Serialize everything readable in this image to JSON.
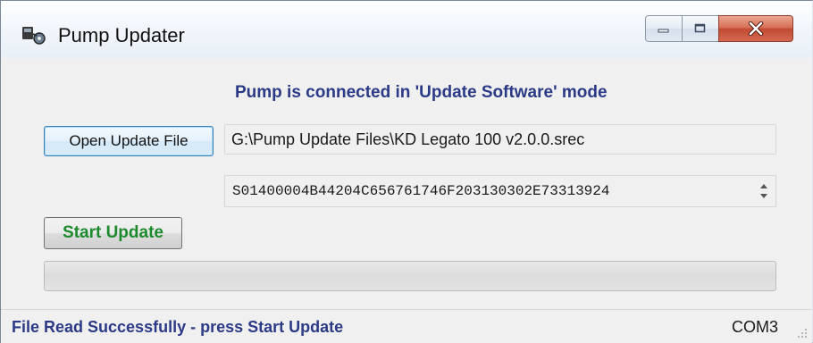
{
  "window": {
    "title": "Pump Updater",
    "app_icon": "pump-updater-app-icon",
    "controls": {
      "minimize_icon": "minimize-icon",
      "maximize_icon": "maximize-icon",
      "close_icon": "close-icon"
    }
  },
  "main": {
    "connection_message": "Pump is connected in 'Update Software' mode",
    "open_button_label": "Open Update File",
    "file_path": "G:\\Pump Update Files\\KD Legato 100 v2.0.0.srec",
    "srec_line": "S01400004B44204C656761746F203130302E73313924",
    "start_button_label": "Start Update",
    "progress_fraction": 0
  },
  "statusbar": {
    "message": "File Read Successfully - press Start Update",
    "port": "COM3"
  },
  "colors": {
    "status_text": "#2b3a86",
    "start_button_text": "#1d8a2e",
    "close_button": "#c24a33",
    "window_background": "#f0f0f0"
  }
}
